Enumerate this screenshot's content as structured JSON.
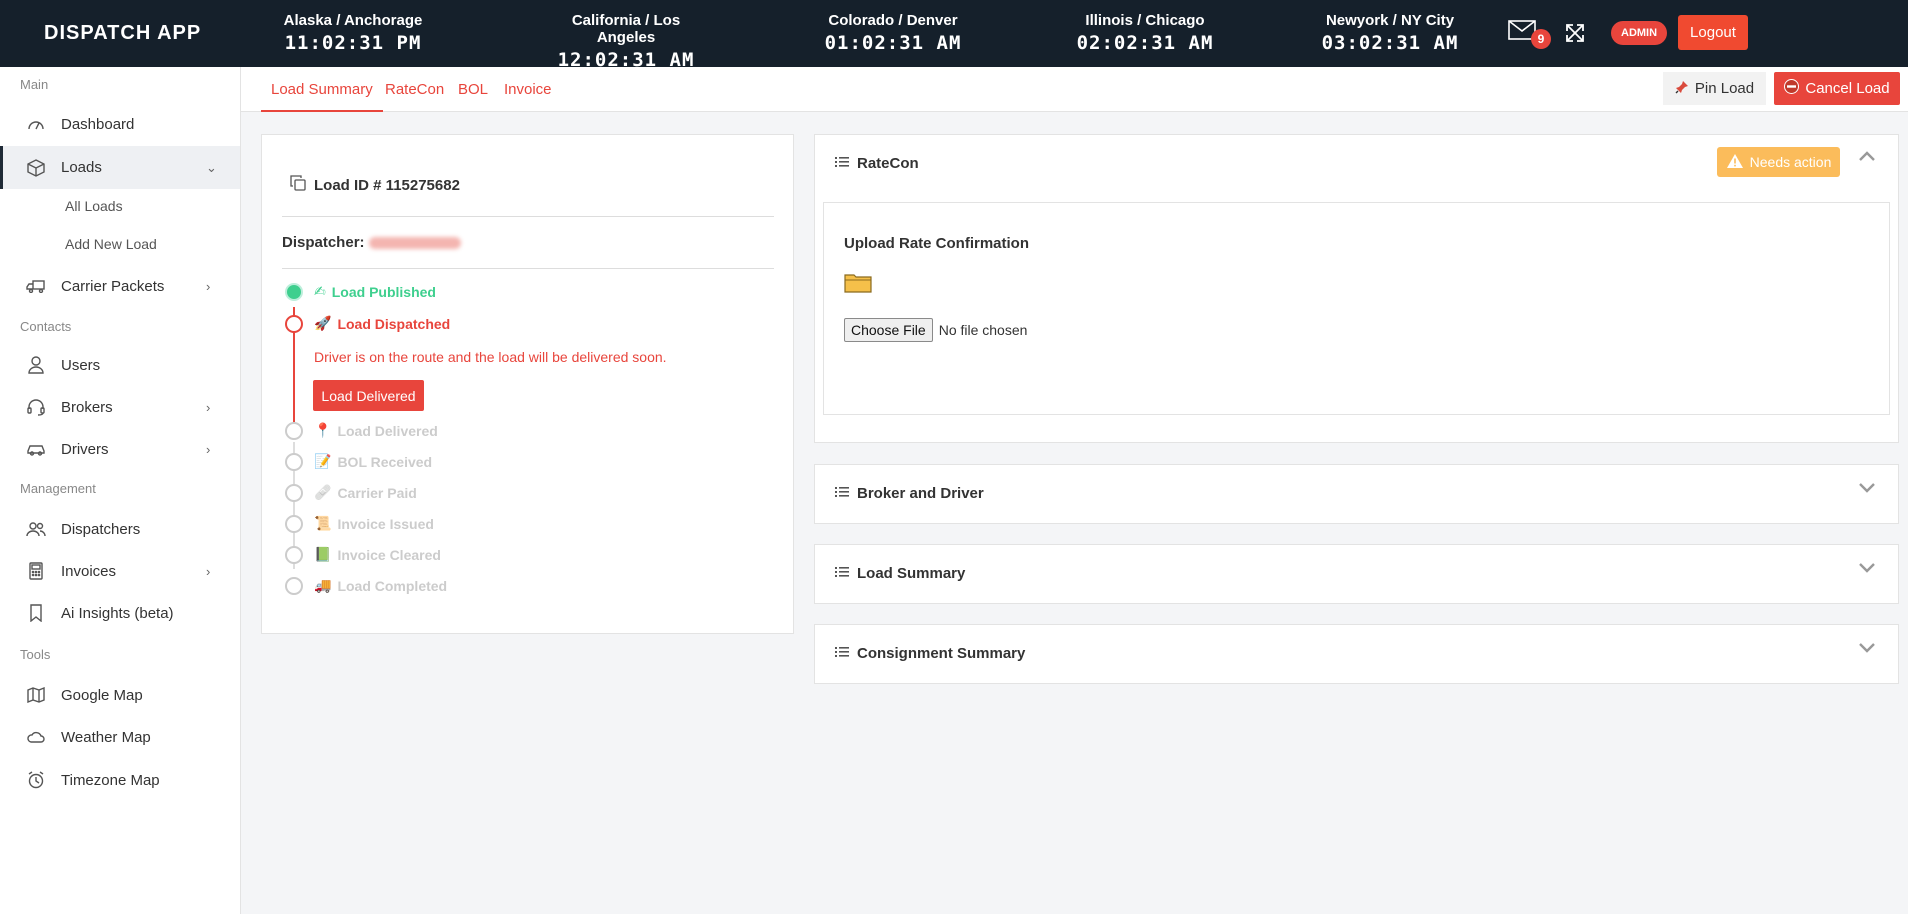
{
  "header": {
    "brand": "DISPATCH APP",
    "clocks": [
      {
        "zone": "Alaska / Anchorage",
        "time": "11:02:31 PM"
      },
      {
        "zone": "California / Los Angeles",
        "time": "12:02:31 AM"
      },
      {
        "zone": "Colorado / Denver",
        "time": "01:02:31 AM"
      },
      {
        "zone": "Illinois / Chicago",
        "time": "02:02:31 AM"
      },
      {
        "zone": "Newyork / NY City",
        "time": "03:02:31 AM"
      }
    ],
    "mail_count": "9",
    "admin_label": "ADMIN",
    "logout_label": "Logout"
  },
  "sidebar": {
    "sections": {
      "main": "Main",
      "contacts": "Contacts",
      "management": "Management",
      "tools": "Tools"
    },
    "items": {
      "dashboard": "Dashboard",
      "loads": "Loads",
      "all_loads": "All Loads",
      "add_new_load": "Add New Load",
      "carrier_packets": "Carrier Packets",
      "users": "Users",
      "brokers": "Brokers",
      "drivers": "Drivers",
      "dispatchers": "Dispatchers",
      "invoices": "Invoices",
      "ai_insights": "Ai Insights (beta)",
      "google_map": "Google Map",
      "weather_map": "Weather Map",
      "timezone_map": "Timezone Map"
    }
  },
  "tabs": [
    "Load Summary",
    "RateCon",
    "BOL",
    "Invoice"
  ],
  "actions": {
    "pin": "Pin Load",
    "cancel": "Cancel Load"
  },
  "load": {
    "id_label": "Load ID # 115275682",
    "dispatcher_label": "Dispatcher:",
    "note": "Driver is on the route and the load will be delivered soon.",
    "deliver_button": "Load Delivered",
    "steps": [
      {
        "label": "Load Published",
        "state": "done"
      },
      {
        "label": "Load Dispatched",
        "state": "current"
      },
      {
        "label": "Load Delivered",
        "state": "pending"
      },
      {
        "label": "BOL Received",
        "state": "pending"
      },
      {
        "label": "Carrier Paid",
        "state": "pending"
      },
      {
        "label": "Invoice Issued",
        "state": "pending"
      },
      {
        "label": "Invoice Cleared",
        "state": "pending"
      },
      {
        "label": "Load Completed",
        "state": "pending"
      }
    ]
  },
  "panels": {
    "ratecon": {
      "title": "RateCon",
      "badge": "Needs action",
      "upload_title": "Upload Rate Confirmation",
      "choose_file": "Choose File",
      "no_file": "No file chosen"
    },
    "broker_driver": "Broker and Driver",
    "load_summary": "Load Summary",
    "consignment_summary": "Consignment Summary"
  },
  "colors": {
    "accent": "#e8453c",
    "header_bg": "#15202b",
    "success": "#3ecf8e",
    "warning": "#fbbc5b"
  }
}
